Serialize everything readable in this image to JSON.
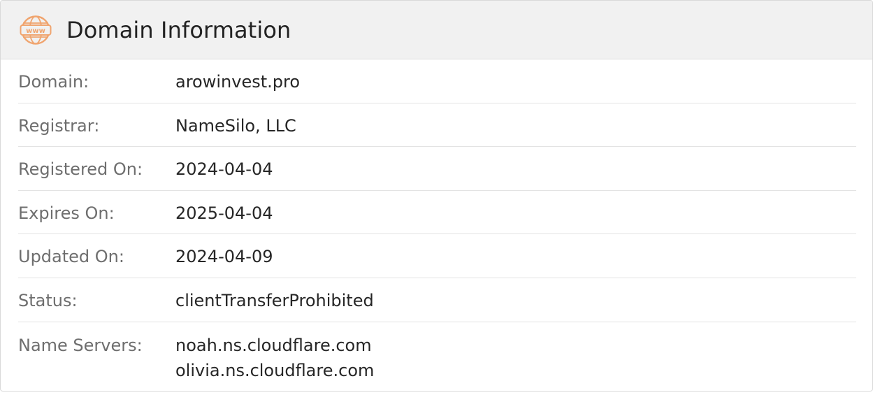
{
  "header": {
    "icon": "www-globe-icon",
    "icon_text": "www",
    "title": "Domain Information",
    "accent_color": "#f0a46e"
  },
  "rows": [
    {
      "label": "Domain:",
      "value": "arowinvest.pro"
    },
    {
      "label": "Registrar:",
      "value": "NameSilo, LLC"
    },
    {
      "label": "Registered On:",
      "value": "2024-04-04"
    },
    {
      "label": "Expires On:",
      "value": "2025-04-04"
    },
    {
      "label": "Updated On:",
      "value": "2024-04-09"
    },
    {
      "label": "Status:",
      "value": "clientTransferProhibited"
    },
    {
      "label": "Name Servers:",
      "values": [
        "noah.ns.cloudflare.com",
        "olivia.ns.cloudflare.com"
      ]
    }
  ]
}
